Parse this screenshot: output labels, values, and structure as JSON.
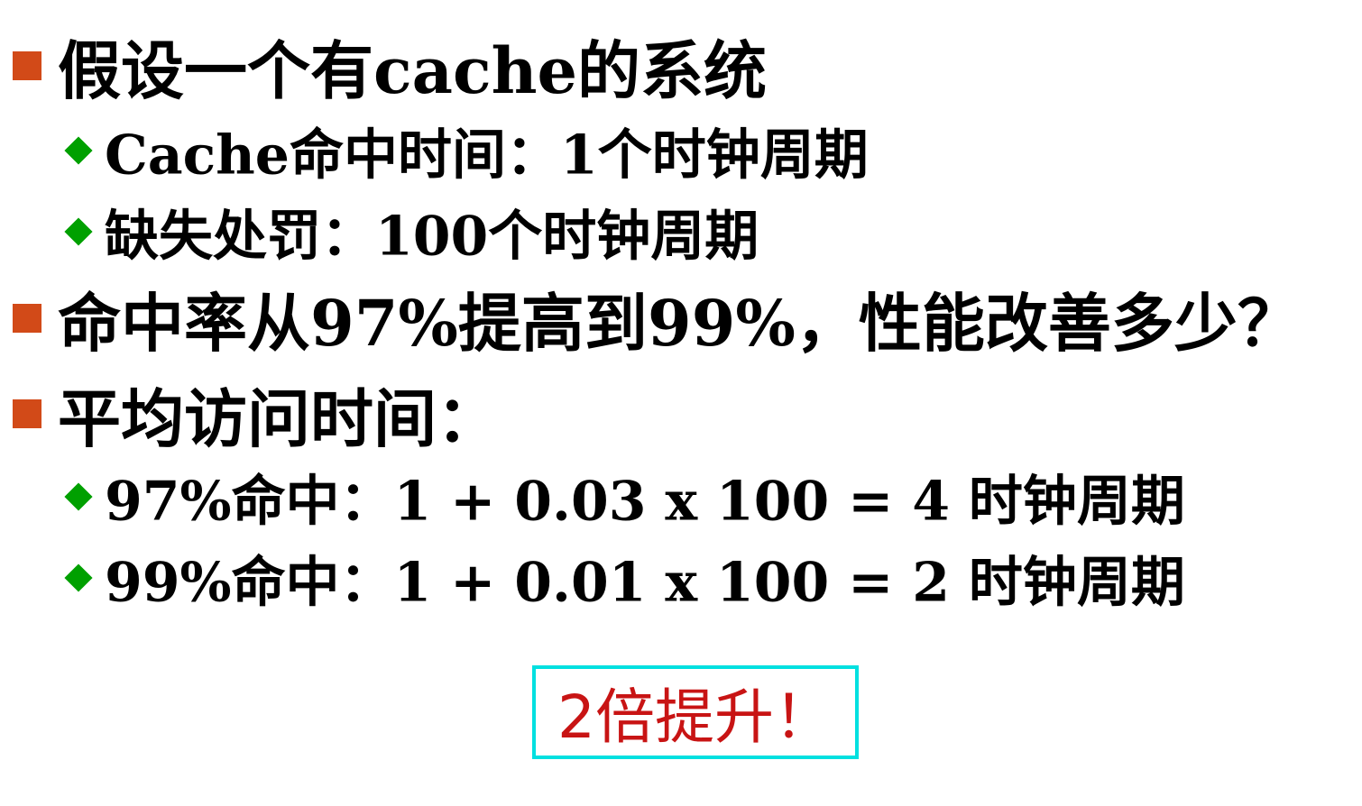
{
  "bullets": [
    {
      "level": 1,
      "icon": "square-bullet-icon",
      "text": "假设一个有cache的系统"
    },
    {
      "level": 2,
      "icon": "diamond-bullet-icon",
      "text": "Cache命中时间：1个时钟周期"
    },
    {
      "level": 2,
      "icon": "diamond-bullet-icon",
      "text": "缺失处罚：100个时钟周期"
    },
    {
      "level": 1,
      "icon": "square-bullet-icon",
      "text": "命中率从97%提高到99%，性能改善多少？"
    },
    {
      "level": 1,
      "icon": "square-bullet-icon",
      "text": "平均访问时间："
    },
    {
      "level": 2,
      "icon": "diamond-bullet-icon",
      "text": "97%命中：1 + 0.03 x 100 = 4 时钟周期"
    },
    {
      "level": 2,
      "icon": "diamond-bullet-icon",
      "text": "99%命中：1 + 0.01 x 100 = 2 时钟周期"
    }
  ],
  "result": "2倍提升！",
  "colors": {
    "square_bullet": "#d24a18",
    "diamond_bullet": "#00a000",
    "result_text": "#c81414",
    "result_border": "#00e0e0"
  }
}
